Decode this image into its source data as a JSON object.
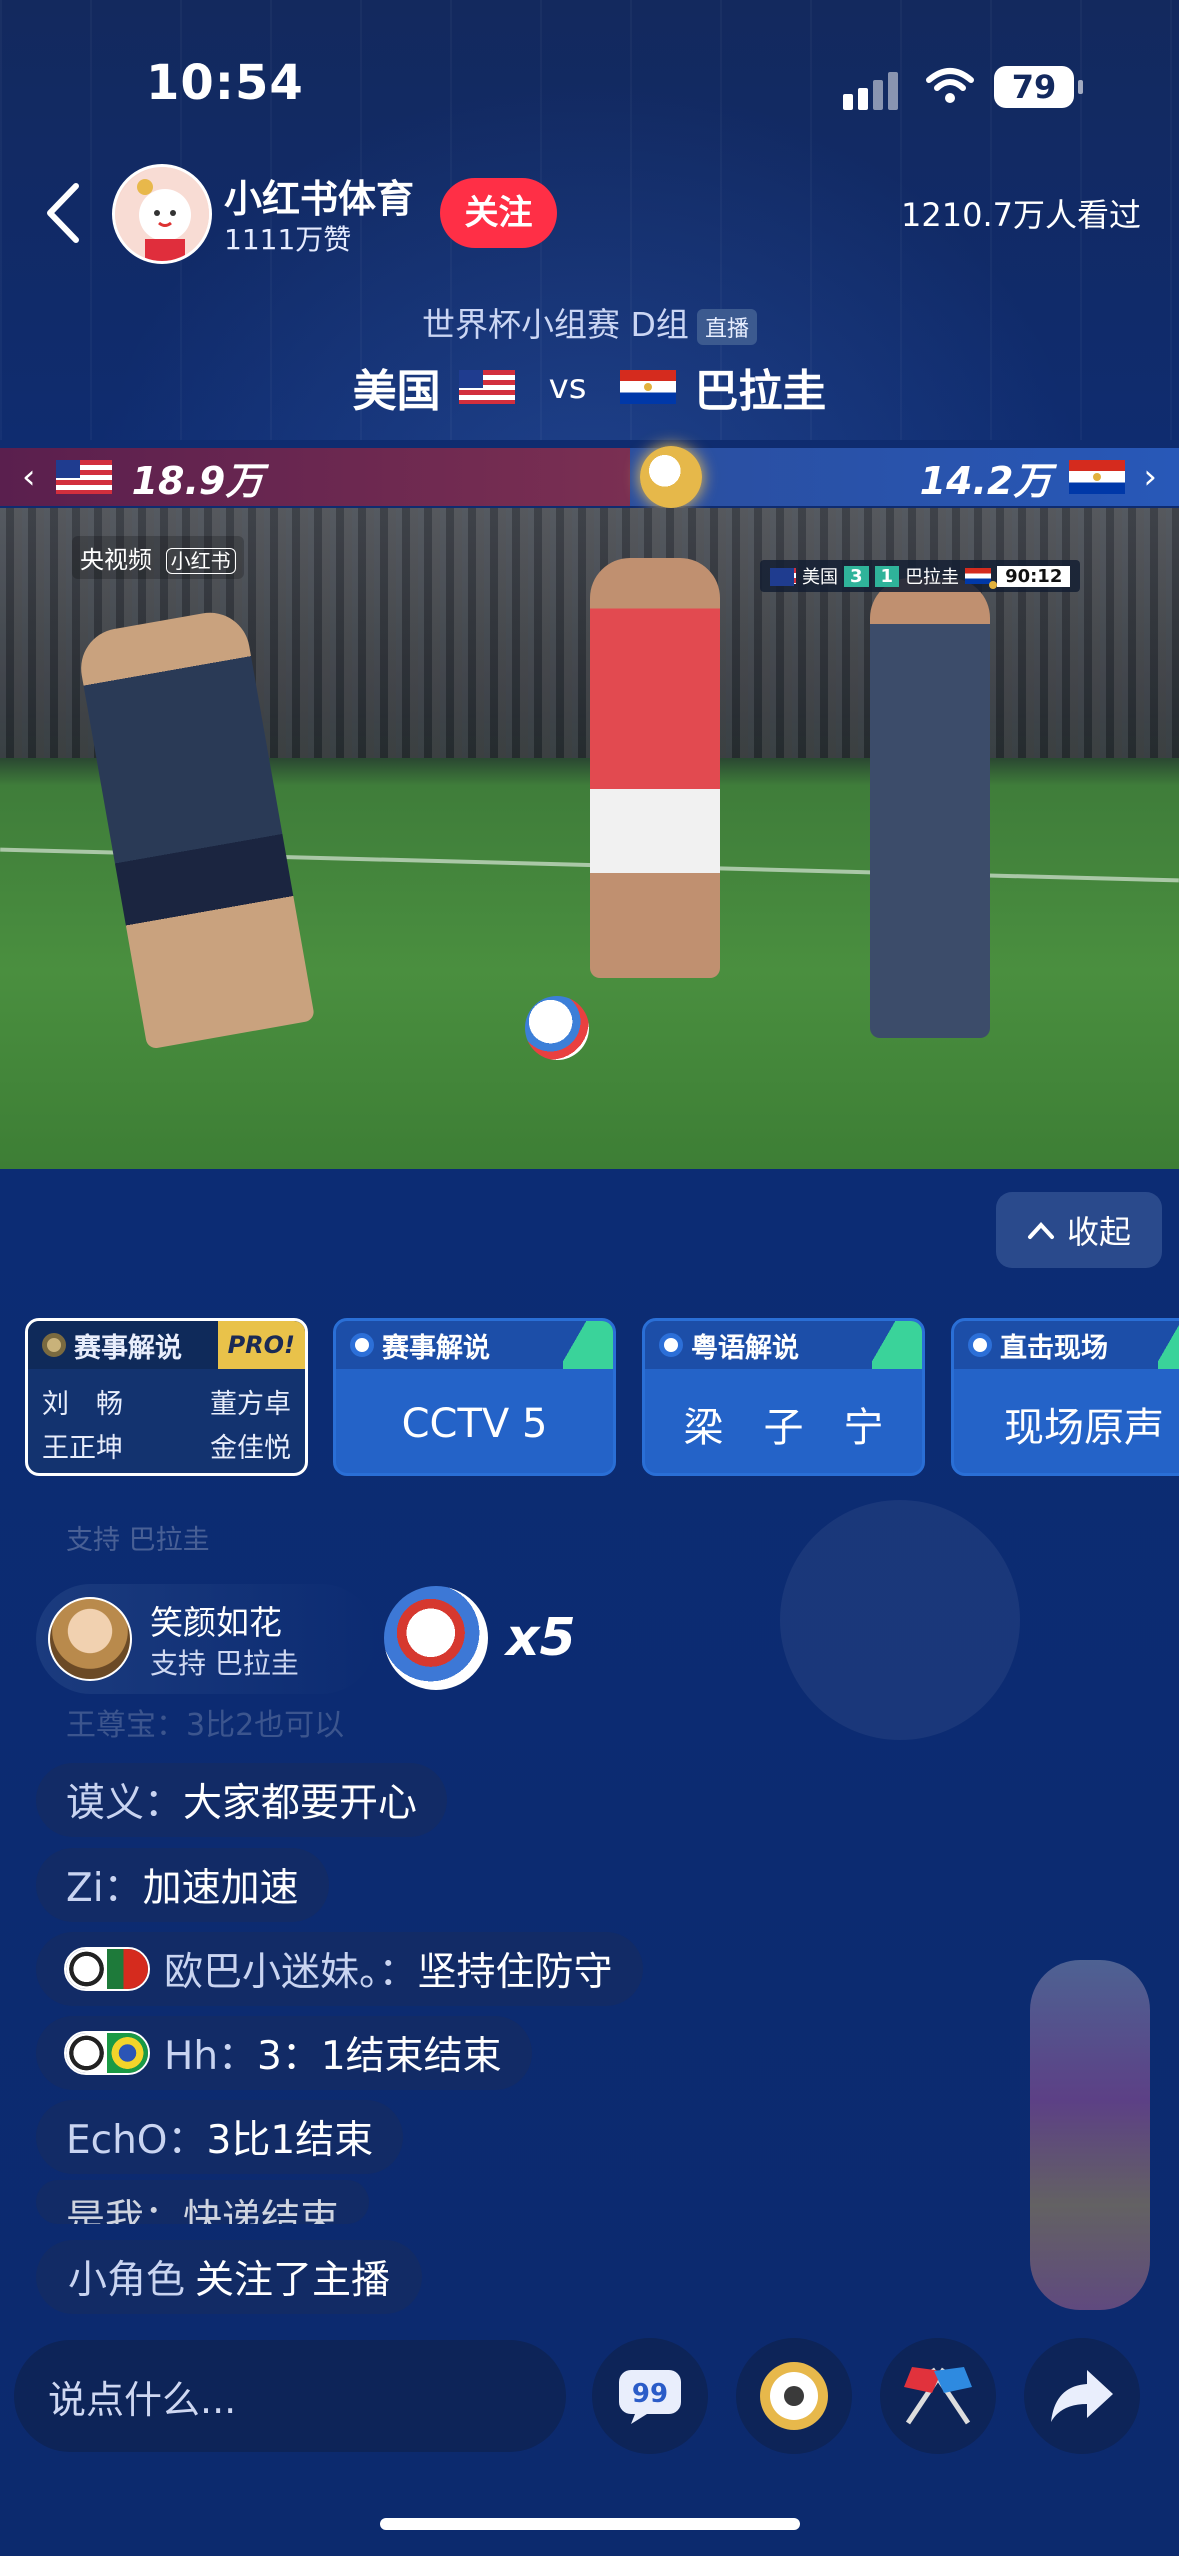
{
  "status": {
    "time": "10:54",
    "battery": "79"
  },
  "host": {
    "name": "小红书体育",
    "likes": "1111万赞",
    "follow_label": "关注",
    "viewers": "1210.7万人看过"
  },
  "match": {
    "stage": "世界杯小组赛 D组",
    "live_tag": "直播",
    "team_home": "美国",
    "vs": "vs",
    "team_away": "巴拉圭"
  },
  "support": {
    "home_count": "18.9万",
    "away_count": "14.2万",
    "left_chevron": "‹",
    "right_chevron": "›"
  },
  "video": {
    "broadcaster": "央视频",
    "brand": "小红书",
    "scorebug": {
      "home": "美国",
      "home_score": "3",
      "away_score": "1",
      "away": "巴拉圭",
      "clock": "90:12"
    }
  },
  "collapse_label": "收起",
  "commentary": [
    {
      "title": "赛事解说",
      "pro": "PRO!",
      "names": [
        "刘　畅",
        "董方卓",
        "王正坤",
        "金佳悦"
      ]
    },
    {
      "title": "赛事解说",
      "body": "CCTV 5"
    },
    {
      "title": "粤语解说",
      "body": "梁　子　宁"
    },
    {
      "title": "直击现场",
      "body": "现场原声"
    }
  ],
  "gift": {
    "user": "笑颜如花",
    "support": "支持 巴拉圭",
    "count": "x5"
  },
  "faded": {
    "top": "支持 巴拉圭",
    "mid": "王尊宝：3比2也可以",
    "bottom": "是我：快递结束"
  },
  "chat": [
    {
      "who": "谟义：",
      "what": "大家都要开心"
    },
    {
      "who": "Zi：",
      "what": "加速加速"
    },
    {
      "who": "欧巴小迷妹。：",
      "what": "坚持住防守"
    },
    {
      "who": "Hh：",
      "what": "3：1结束结束"
    },
    {
      "who": "EchO：",
      "what": "3比1结束"
    }
  ],
  "follow_notice": {
    "who": "小角色",
    "what": "关注了主播"
  },
  "input_placeholder": "说点什么...",
  "colors": {
    "accent_red": "#ff2f46",
    "bg": "#0c2c74",
    "card_blue": "#2463c8",
    "pro_gold": "#e9c24a"
  }
}
